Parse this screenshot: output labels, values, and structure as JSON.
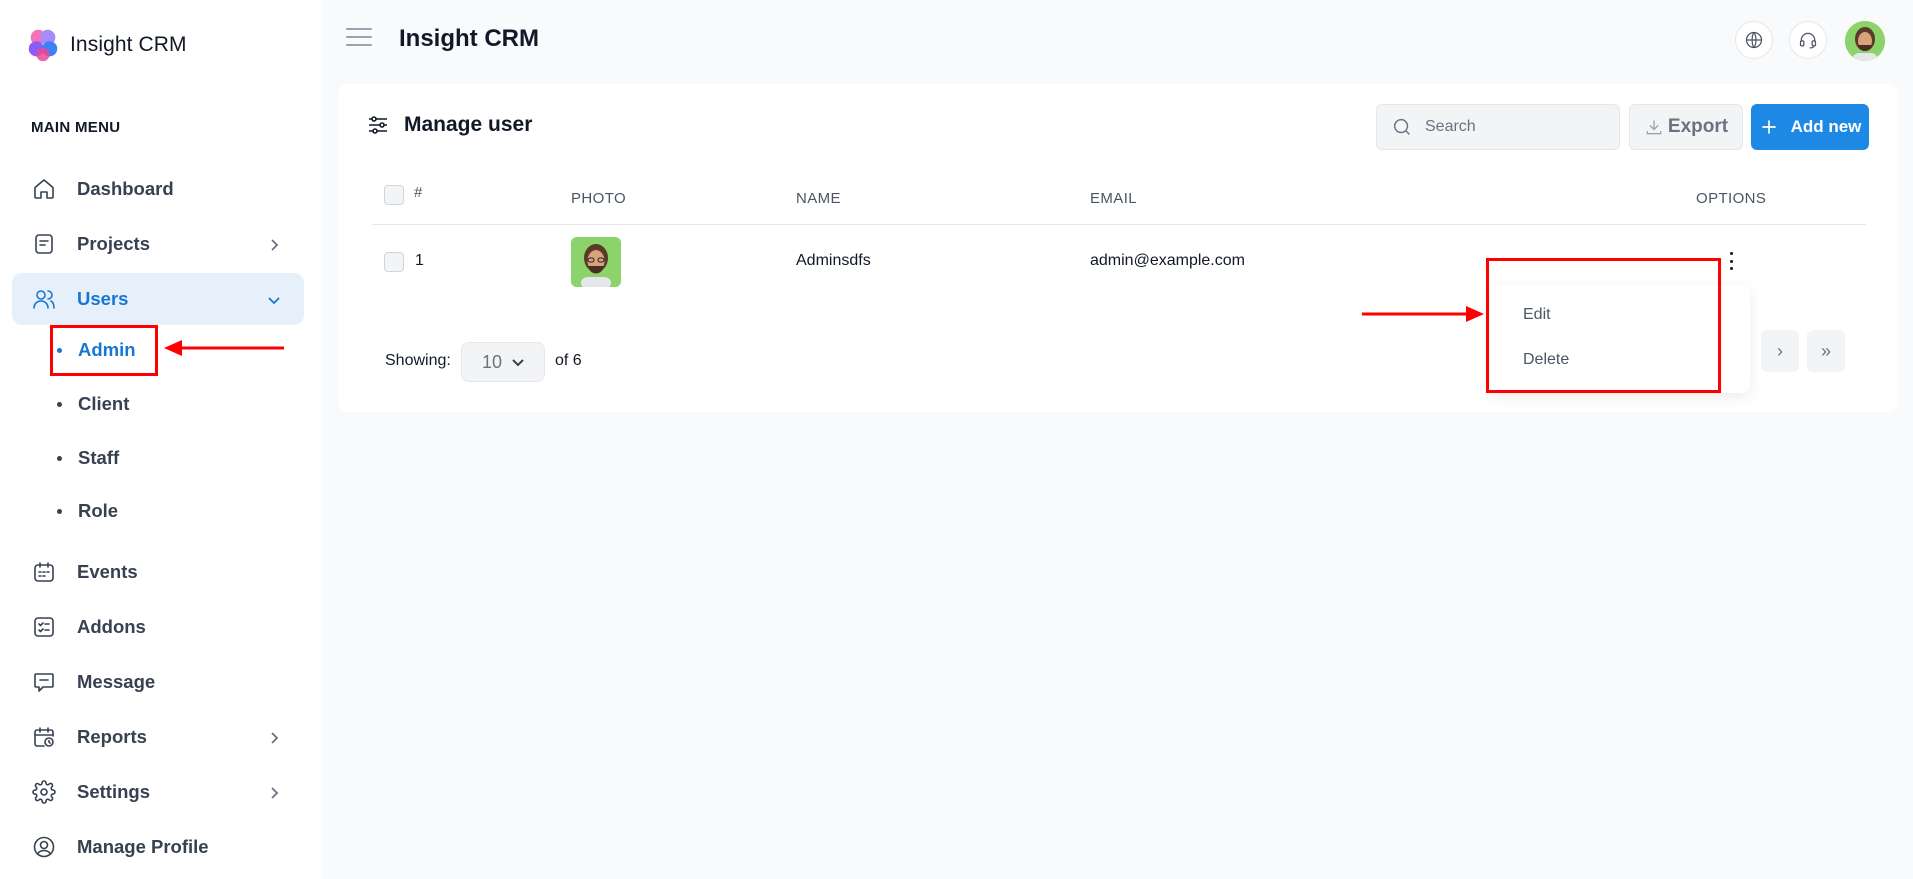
{
  "app": {
    "name": "Insight CRM"
  },
  "sidebar": {
    "menu_title": "MAIN MENU",
    "items": [
      {
        "label": "Dashboard",
        "icon": "home-icon"
      },
      {
        "label": "Projects",
        "icon": "clipboard-icon"
      },
      {
        "label": "Users",
        "icon": "users-icon"
      },
      {
        "label": "Events",
        "icon": "calendar-icon"
      },
      {
        "label": "Addons",
        "icon": "checklist-icon"
      },
      {
        "label": "Message",
        "icon": "message-icon"
      },
      {
        "label": "Reports",
        "icon": "calendar-clock-icon"
      },
      {
        "label": "Settings",
        "icon": "gear-icon"
      },
      {
        "label": "Manage Profile",
        "icon": "user-circle-icon"
      }
    ],
    "users_submenu": [
      {
        "label": "Admin"
      },
      {
        "label": "Client"
      },
      {
        "label": "Staff"
      },
      {
        "label": "Role"
      }
    ]
  },
  "header": {
    "title": "Insight CRM"
  },
  "card": {
    "title": "Manage user",
    "search_placeholder": "Search",
    "export_label": "Export",
    "add_label": "Add new"
  },
  "table": {
    "columns": [
      "#",
      "PHOTO",
      "NAME",
      "EMAIL",
      "OPTIONS"
    ],
    "rows": [
      {
        "index": "1",
        "name": "Adminsdfs",
        "email": "admin@example.com"
      }
    ]
  },
  "pagination": {
    "showing_label": "Showing:",
    "per_page": "10",
    "of_total": "of 6",
    "next": "›",
    "last": "»"
  },
  "dropdown": {
    "edit": "Edit",
    "delete": "Delete"
  },
  "colors": {
    "accent": "#1e88e5",
    "active_nav_bg": "#e6f0fb",
    "annotation": "#ff0000"
  }
}
